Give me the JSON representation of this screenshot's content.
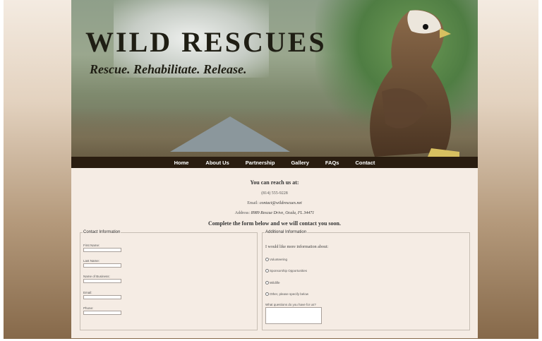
{
  "banner": {
    "title": "WILD RESCUES",
    "tagline": "Rescue. Rehabilitate. Release."
  },
  "nav": {
    "items": [
      "Home",
      "About Us",
      "Partnership",
      "Gallery",
      "FAQs",
      "Contact"
    ]
  },
  "contact": {
    "heading": "You can reach us at:",
    "phone": "(814) 555-9228",
    "email_label": "Email:",
    "email": "contact@wildrescues.net",
    "address_label": "Address:",
    "address": "8989 Rescue Drive, Ocala, FL 34471",
    "cta": "Complete the form below and we will contact you soon."
  },
  "contact_form": {
    "legend": "Contact Information",
    "fields": [
      "First Name:",
      "Last Name:",
      "Name of Business:",
      "Email:",
      "Phone:"
    ]
  },
  "additional_form": {
    "legend": "Additional Information",
    "intro": "I would like more information about:",
    "options": [
      "Volunteering",
      "Sponsorship Opportunities",
      "Wildlife",
      "Other, please specify below"
    ],
    "question_label": "What questions do you have for us?"
  },
  "colors": {
    "nav_bg": "#2a1d10",
    "content_bg": "#f5ece4",
    "page_gradient_bottom": "#86694a"
  }
}
